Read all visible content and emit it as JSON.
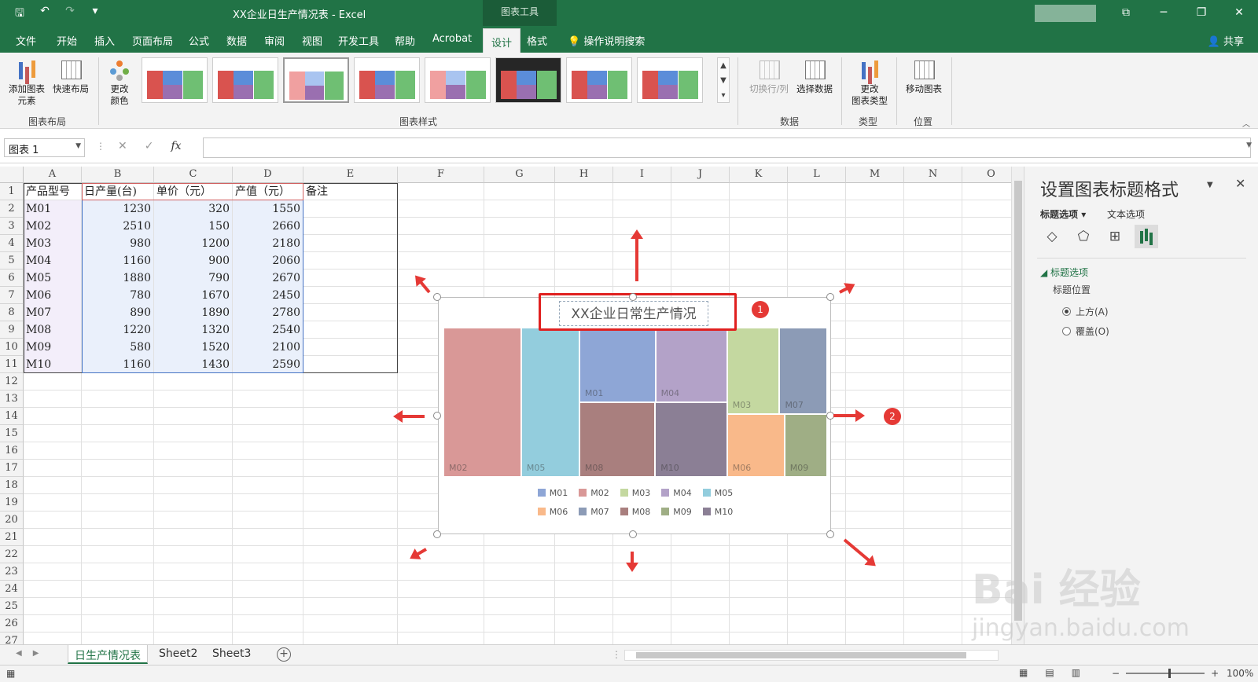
{
  "window": {
    "title": "XX企业日生产情况表  -  Excel",
    "context_tab": "图表工具",
    "share": "共享"
  },
  "menu": {
    "tabs": [
      "文件",
      "开始",
      "插入",
      "页面布局",
      "公式",
      "数据",
      "审阅",
      "视图",
      "开发工具",
      "帮助",
      "Acrobat",
      "设计",
      "格式"
    ],
    "active": "设计",
    "tellme": "操作说明搜索"
  },
  "ribbon": {
    "add_element": "添加图表\n元素",
    "quick_layout": "快速布局",
    "change_color": "更改\n颜色",
    "switch_row_col": "切换行/列",
    "select_data": "选择数据",
    "change_type": "更改\n图表类型",
    "move_chart": "移动图表",
    "groups": {
      "layout": "图表布局",
      "styles": "图表样式",
      "data": "数据",
      "type": "类型",
      "location": "位置"
    }
  },
  "formula": {
    "namebox": "图表 1",
    "fx": "fx",
    "value": ""
  },
  "columns": [
    "A",
    "B",
    "C",
    "D",
    "E",
    "F",
    "G",
    "H",
    "I",
    "J",
    "K",
    "L",
    "M",
    "N",
    "O"
  ],
  "rows": [
    "1",
    "2",
    "3",
    "4",
    "5",
    "6",
    "7",
    "8",
    "9",
    "10",
    "11",
    "12",
    "13",
    "14",
    "15",
    "16",
    "17",
    "18",
    "19",
    "20",
    "21",
    "22",
    "23",
    "24",
    "25",
    "26",
    "27"
  ],
  "table": {
    "headers": [
      "产品型号",
      "日产量(台)",
      "单价（元）",
      "产值（元）",
      "备注"
    ],
    "data": [
      [
        "M01",
        "1230",
        "320",
        "1550"
      ],
      [
        "M02",
        "2510",
        "150",
        "2660"
      ],
      [
        "M03",
        "980",
        "1200",
        "2180"
      ],
      [
        "M04",
        "1160",
        "900",
        "2060"
      ],
      [
        "M05",
        "1880",
        "790",
        "2670"
      ],
      [
        "M06",
        "780",
        "1670",
        "2450"
      ],
      [
        "M07",
        "890",
        "1890",
        "2780"
      ],
      [
        "M08",
        "1220",
        "1320",
        "2540"
      ],
      [
        "M09",
        "580",
        "1520",
        "2100"
      ],
      [
        "M10",
        "1160",
        "1430",
        "2590"
      ]
    ]
  },
  "chart": {
    "title": "XX企业日常生产情况",
    "badge1": "1",
    "badge2": "2",
    "legend": [
      "M01",
      "M02",
      "M03",
      "M04",
      "M05",
      "M06",
      "M07",
      "M08",
      "M09",
      "M10"
    ],
    "colors": {
      "M01": "#8ea6d6",
      "M02": "#d99897",
      "M03": "#c4d8a0",
      "M04": "#b3a2c8",
      "M05": "#93cddd",
      "M06": "#f9b98a",
      "M07": "#8c9bb6",
      "M08": "#a97f7e",
      "M09": "#9fae85",
      "M10": "#8b7f95"
    }
  },
  "chart_data": {
    "type": "treemap",
    "title": "XX企业日常生产情况",
    "categories": [
      "M02",
      "M05",
      "M01",
      "M04",
      "M08",
      "M10",
      "M03",
      "M07",
      "M06",
      "M09"
    ],
    "values": [
      2510,
      1880,
      1230,
      1160,
      1220,
      1160,
      980,
      890,
      780,
      580
    ],
    "legend": "bottom"
  },
  "pane": {
    "title": "设置图表标题格式",
    "tab1": "标题选项",
    "tab2": "文本选项",
    "section": "标题选项",
    "label": "标题位置",
    "opt1": "上方(A)",
    "opt2": "覆盖(O)"
  },
  "sheets": {
    "tabs": [
      "日生产情况表",
      "Sheet2",
      "Sheet3"
    ],
    "active": "日生产情况表"
  },
  "status": {
    "zoom": "100%"
  },
  "watermark": {
    "main": "Bai  经验",
    "sub": "jingyan.baidu.com"
  }
}
